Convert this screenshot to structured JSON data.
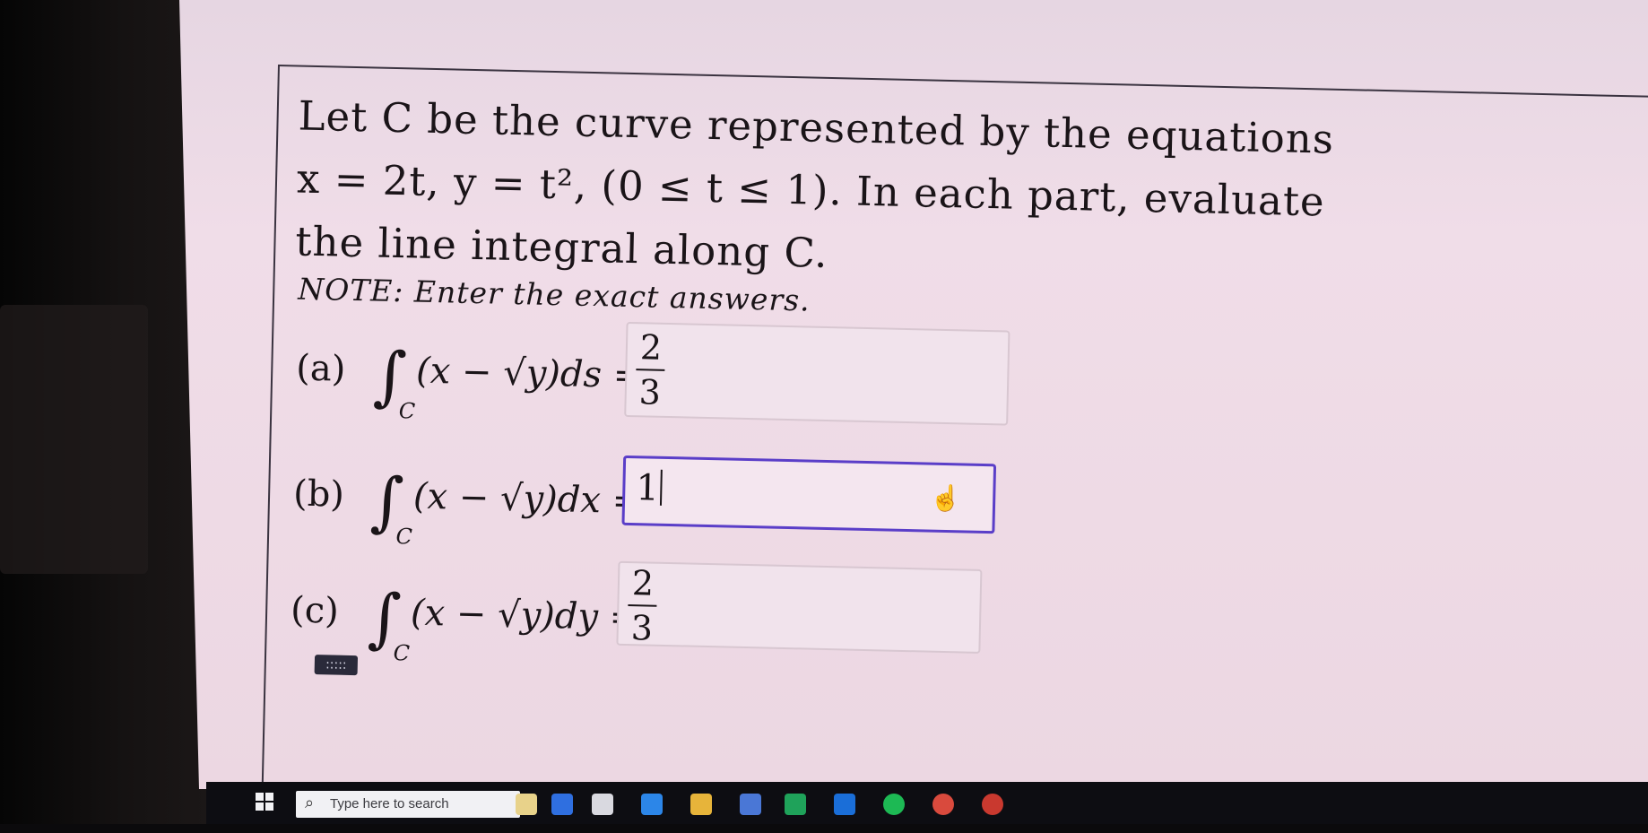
{
  "question": {
    "stem_line1": "Let C be the curve represented by the equations",
    "stem_line2": "x = 2t, y = t², (0 ≤ t ≤ 1). In each part, evaluate",
    "stem_line3": "the line integral along C.",
    "note": "NOTE: Enter the exact answers."
  },
  "parts": [
    {
      "label": "(a)",
      "integrand": "(x − √y)ds =",
      "subscript": "C",
      "answer_num": "2",
      "answer_den": "3"
    },
    {
      "label": "(b)",
      "integrand": "(x − √y)dx =",
      "subscript": "C",
      "answer_value": "1"
    },
    {
      "label": "(c)",
      "integrand": "(x − √y)dy =",
      "subscript": "C",
      "answer_num": "2",
      "answer_den": "3"
    }
  ],
  "keypad_label": ":::::",
  "taskbar": {
    "search_placeholder": "Type here to search"
  },
  "colors": {
    "active_border": "#5a3ec8",
    "page_bg": "#f0dde8",
    "taskbar": "#14131a"
  }
}
